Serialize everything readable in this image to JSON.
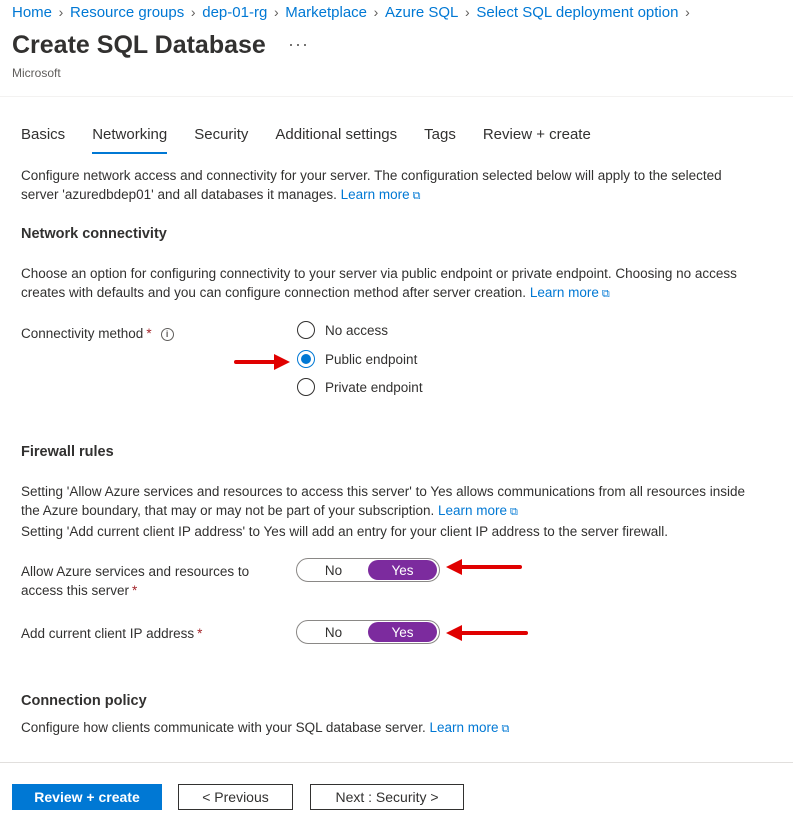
{
  "breadcrumb": [
    "Home",
    "Resource groups",
    "dep-01-rg",
    "Marketplace",
    "Azure SQL",
    "Select SQL deployment option"
  ],
  "header": {
    "title": "Create SQL Database",
    "more": "···",
    "subtitle": "Microsoft"
  },
  "tabs": [
    "Basics",
    "Networking",
    "Security",
    "Additional settings",
    "Tags",
    "Review + create"
  ],
  "active_tab": "Networking",
  "intro": {
    "line1": "Configure network access and connectivity for your server. The configuration selected below will apply to the selected",
    "line2": "server 'azuredbdep01' and all databases it manages.",
    "link": "Learn more"
  },
  "network": {
    "title": "Network connectivity",
    "line1": "Choose an option for configuring connectivity to your server via public endpoint or private endpoint. Choosing no access",
    "line2": "creates with defaults and you can configure connection method after server creation.",
    "link": "Learn more",
    "method_label": "Connectivity method",
    "required": "*",
    "info": "i",
    "options": [
      "No access",
      "Public endpoint",
      "Private endpoint"
    ],
    "selected": "Public endpoint"
  },
  "firewall": {
    "title": "Firewall rules",
    "line1": "Setting 'Allow Azure services and resources to access this server' to Yes allows communications from all resources inside",
    "line2": "the Azure boundary, that may or may not be part of your subscription.",
    "link": "Learn more",
    "line3": "Setting 'Add current client IP address' to Yes will add an entry for your client IP address to the server firewall.",
    "allow_label_1": "Allow Azure services and resources to",
    "allow_label_2": "access this server",
    "client_ip_label": "Add current client IP address",
    "required": "*",
    "no": "No",
    "yes": "Yes",
    "allow_value": "Yes",
    "client_ip_value": "Yes"
  },
  "policy": {
    "title": "Connection policy",
    "text": "Configure how clients communicate with your SQL database server.",
    "link": "Learn more"
  },
  "footer": {
    "review": "Review + create",
    "previous": "< Previous",
    "next": "Next : Security >"
  },
  "colors": {
    "accent": "#0078d4",
    "toggle_on": "#7c2b9e",
    "annotation_arrow": "#e00000",
    "required": "#a4262c"
  }
}
